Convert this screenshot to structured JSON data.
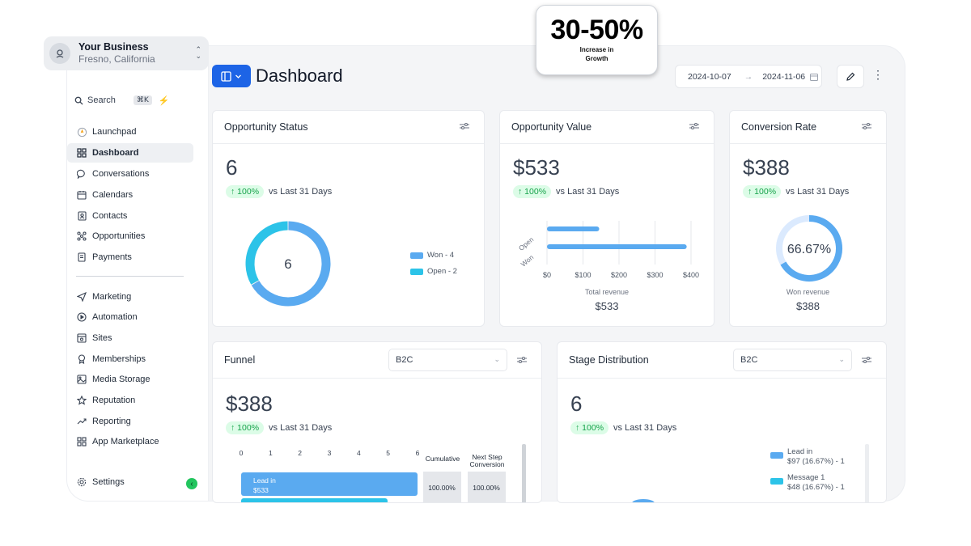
{
  "callout": {
    "value": "30-50%",
    "line1": "Increase in",
    "line2": "Growth"
  },
  "account": {
    "name": "Your Business",
    "location": "Fresno, California"
  },
  "search": {
    "placeholder": "Search",
    "shortcut": "⌘K"
  },
  "sidebar": {
    "primary": [
      {
        "label": "Launchpad",
        "icon": "rocket-icon"
      },
      {
        "label": "Dashboard",
        "icon": "grid-icon",
        "active": true
      },
      {
        "label": "Conversations",
        "icon": "chat-icon"
      },
      {
        "label": "Calendars",
        "icon": "calendar-icon"
      },
      {
        "label": "Contacts",
        "icon": "contacts-icon"
      },
      {
        "label": "Opportunities",
        "icon": "opportunities-icon"
      },
      {
        "label": "Payments",
        "icon": "payments-icon"
      }
    ],
    "secondary": [
      {
        "label": "Marketing",
        "icon": "send-icon"
      },
      {
        "label": "Automation",
        "icon": "automation-icon"
      },
      {
        "label": "Sites",
        "icon": "sites-icon"
      },
      {
        "label": "Memberships",
        "icon": "award-icon"
      },
      {
        "label": "Media Storage",
        "icon": "image-icon"
      },
      {
        "label": "Reputation",
        "icon": "star-icon"
      },
      {
        "label": "Reporting",
        "icon": "trend-icon"
      },
      {
        "label": "App Marketplace",
        "icon": "apps-icon"
      }
    ],
    "settings": "Settings"
  },
  "header": {
    "title": "Dashboard",
    "date_from": "2024-10-07",
    "date_to": "2024-11-06"
  },
  "colors": {
    "primary": "#1d64e6",
    "blue": "#5aaaf0",
    "cyan": "#2cc3e8",
    "green_badge": "#dcfce7",
    "green_text": "#16a34a"
  },
  "cards": {
    "opportunity_status": {
      "title": "Opportunity Status",
      "value": "6",
      "change": "100%",
      "comparison": "vs Last 31 Days",
      "donut_center": "6",
      "legend": [
        {
          "label": "Won - 4",
          "value": 4,
          "color": "#5aaaf0"
        },
        {
          "label": "Open - 2",
          "value": 2,
          "color": "#2cc3e8"
        }
      ]
    },
    "opportunity_value": {
      "title": "Opportunity Value",
      "value": "$533",
      "change": "100%",
      "comparison": "vs Last 31 Days",
      "bars": [
        {
          "label": "Open",
          "value": 145
        },
        {
          "label": "Won",
          "value": 388
        }
      ],
      "ticks": [
        "$0",
        "$100",
        "$200",
        "$300",
        "$400"
      ],
      "footer_label": "Total revenue",
      "footer_value": "$533"
    },
    "conversion_rate": {
      "title": "Conversion Rate",
      "value": "$388",
      "change": "100%",
      "comparison": "vs Last 31 Days",
      "gauge_text": "66.67%",
      "gauge_fraction": 0.6667,
      "footer_label": "Won revenue",
      "footer_value": "$388"
    },
    "funnel": {
      "title": "Funnel",
      "select": "B2C",
      "value": "$388",
      "change": "100%",
      "comparison": "vs Last 31 Days",
      "ticks": [
        "0",
        "1",
        "2",
        "3",
        "4",
        "5",
        "6"
      ],
      "col_cumulative": "Cumulative",
      "col_next_line1": "Next Step",
      "col_next_line2": "Conversion",
      "rows": [
        {
          "label": "Lead in",
          "amount": "$533",
          "count": 6,
          "cumulative": "100.00%",
          "next": "100.00%"
        }
      ]
    },
    "stage_distribution": {
      "title": "Stage Distribution",
      "select": "B2C",
      "value": "6",
      "change": "100%",
      "comparison": "vs Last 31 Days",
      "legend": [
        {
          "name": "Lead in",
          "detail": "$97 (16.67%) - 1",
          "color": "#5aaaf0"
        },
        {
          "name": "Message 1",
          "detail": "$48 (16.67%) - 1",
          "color": "#2cc3e8"
        }
      ]
    }
  }
}
